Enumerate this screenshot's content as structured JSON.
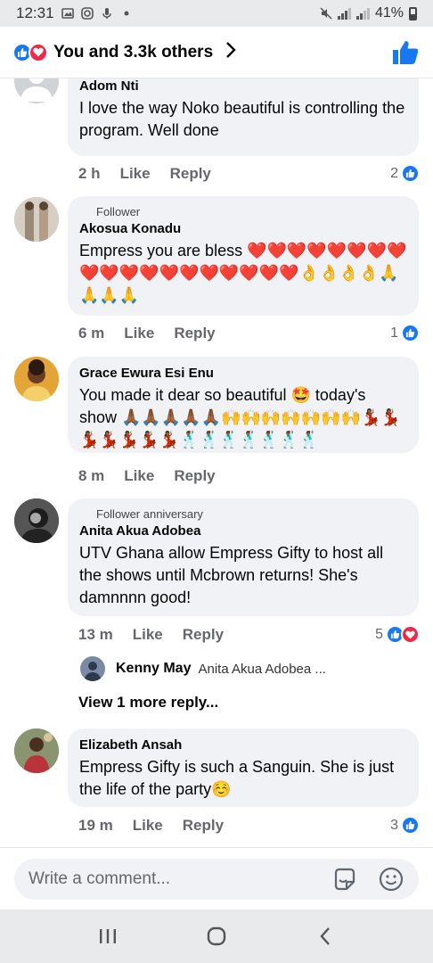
{
  "status_bar": {
    "time": "12:31",
    "battery": "41%"
  },
  "header": {
    "reactions_text": "You and 3.3k others"
  },
  "comments": [
    {
      "badge": "",
      "name": "Adom Nti",
      "text": "I love the way Noko beautiful is controlling the program. Well done",
      "time": "2 h",
      "like": "Like",
      "reply": "Reply",
      "reaction_count": "2"
    },
    {
      "badge": "Follower",
      "name": "Akosua Konadu",
      "text": "Empress you are bless ❤️❤️❤️❤️❤️❤️❤️❤️❤️❤️❤️❤️❤️❤️❤️❤️❤️❤️❤️👌👌👌👌🙏🙏🙏🙏",
      "time": "6 m",
      "like": "Like",
      "reply": "Reply",
      "reaction_count": "1"
    },
    {
      "badge": "",
      "name": "Grace Ewura Esi Enu",
      "text": "You made it dear so beautiful 🤩 today's show 🙏🏾🙏🏾🙏🏾🙏🏾🙏🏾🙌🙌🙌🙌🙌🙌🙌💃🏾💃🏾💃🏾💃🏾💃🏾💃🏾💃🏾🕺🏾🕺🏾🕺🏾🕺🏾🕺🏾🕺🏾🕺🏾",
      "time": "8 m",
      "like": "Like",
      "reply": "Reply",
      "reaction_count": ""
    },
    {
      "badge": "Follower anniversary",
      "name": "Anita Akua Adobea",
      "text": "UTV Ghana allow Empress Gifty to host all the shows until Mcbrown returns! She's damnnnn good!",
      "time": "13 m",
      "like": "Like",
      "reply": "Reply",
      "reaction_count": "5"
    },
    {
      "badge": "",
      "name": "Elizabeth Ansah",
      "text": "Empress Gifty is such a Sanguin. She is just the life of the party☺️",
      "time": "19 m",
      "like": "Like",
      "reply": "Reply",
      "reaction_count": "3"
    }
  ],
  "reply_preview": {
    "name": "Kenny May",
    "text": "Anita Akua Adobea ..."
  },
  "view_more": "View 1 more reply...",
  "composer": {
    "placeholder": "Write a comment..."
  },
  "icons": {
    "like_color": "#1877f2",
    "love_color": "#f0284a"
  }
}
